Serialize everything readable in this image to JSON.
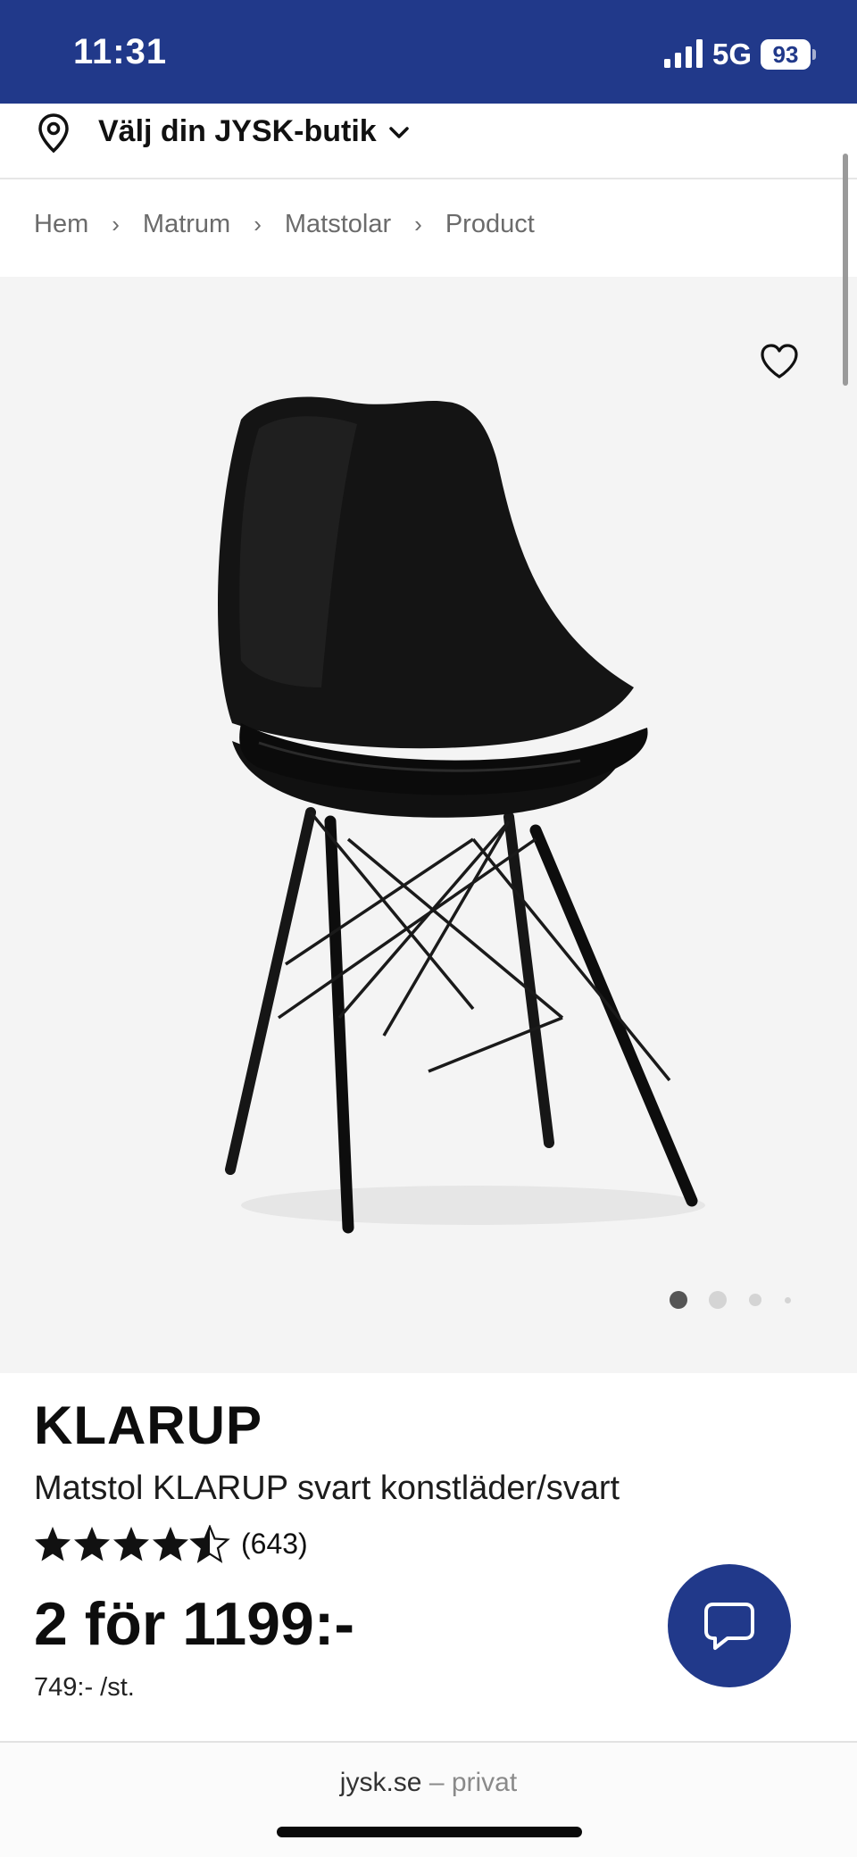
{
  "status_bar": {
    "time": "11:31",
    "network": "5G",
    "battery": "93"
  },
  "store_selector": {
    "label": "Välj din JYSK-butik",
    "icon": "location-pin-icon"
  },
  "breadcrumb": [
    "Hem",
    "Matrum",
    "Matstolar",
    "Product"
  ],
  "gallery": {
    "image_count": 4,
    "active_index": 0
  },
  "product": {
    "brand": "KLARUP",
    "title": "Matstol KLARUP svart konstläder/svart",
    "rating": 4.5,
    "rating_max": 5,
    "review_count": "(643)",
    "price": "2 för 1199:-",
    "unit_price": "749:- /st."
  },
  "footer": {
    "domain": "jysk.se",
    "suffix": "– privat"
  },
  "colors": {
    "brand_blue": "#21398a",
    "image_bg": "#f4f4f4"
  }
}
